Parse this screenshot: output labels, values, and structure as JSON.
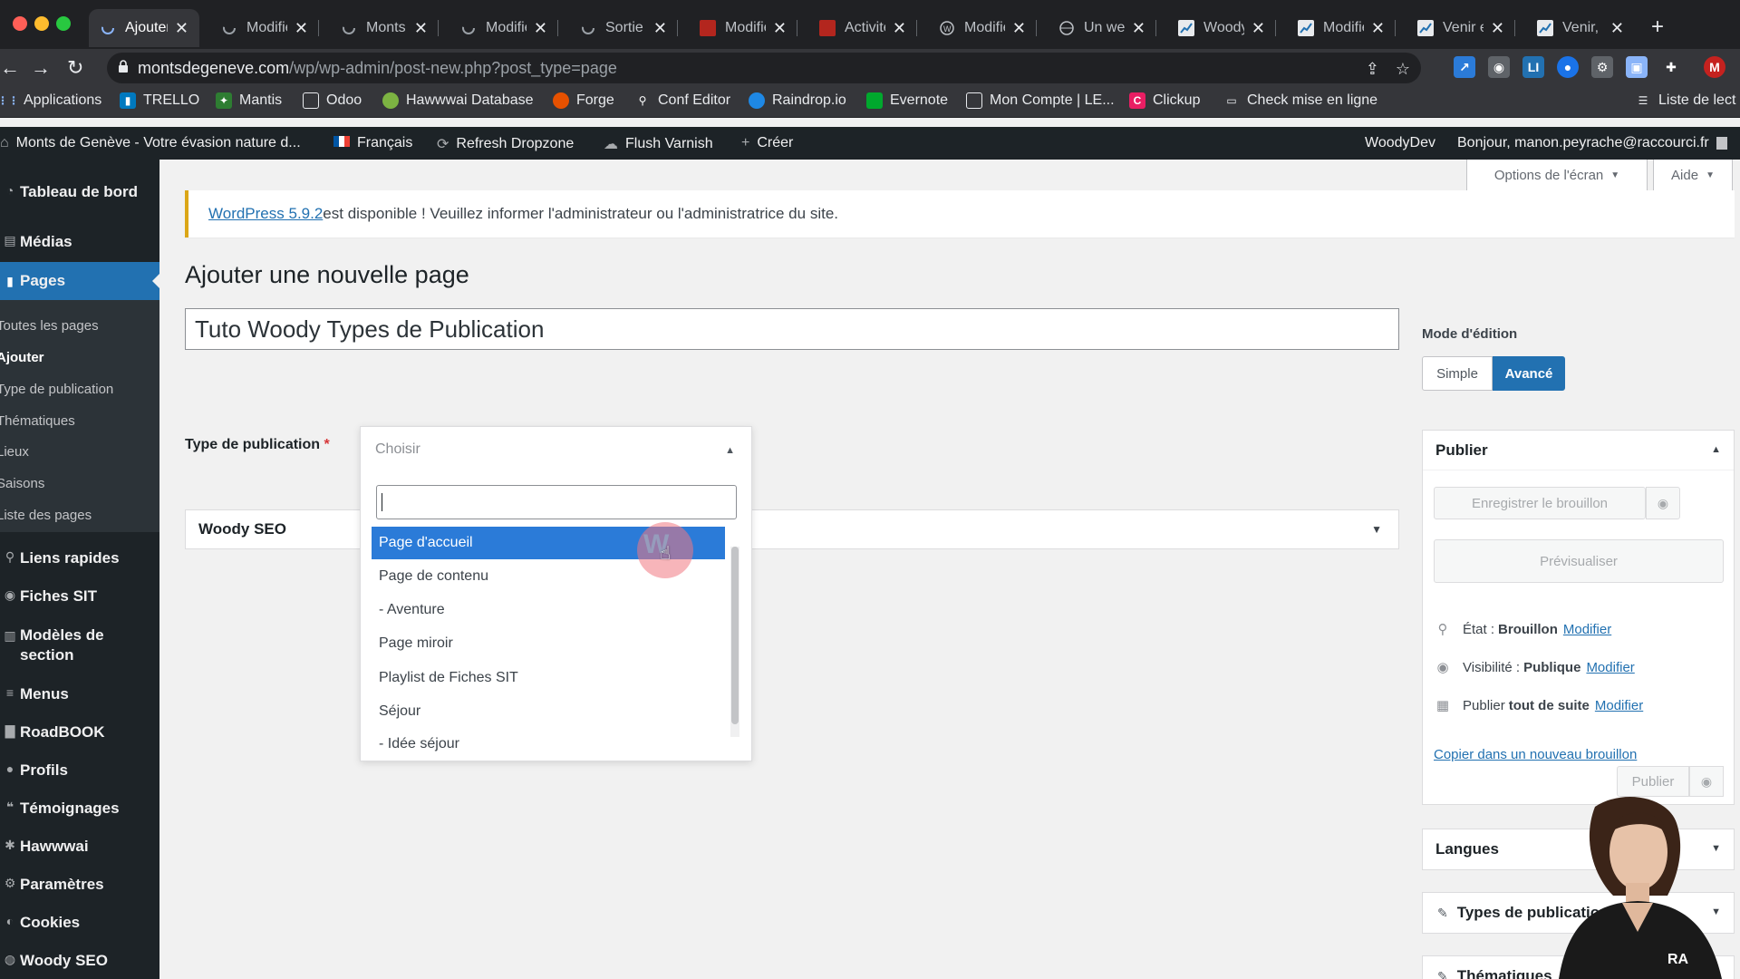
{
  "browser": {
    "tabs": [
      {
        "title": "Ajouter",
        "active": true
      },
      {
        "title": "Modifie"
      },
      {
        "title": "Monts"
      },
      {
        "title": "Modifie"
      },
      {
        "title": "Sortie"
      },
      {
        "title": "Modifie"
      },
      {
        "title": "Activité"
      },
      {
        "title": "Modifie"
      },
      {
        "title": "Un we"
      },
      {
        "title": "Woody"
      },
      {
        "title": "Modifie"
      },
      {
        "title": "Venir e"
      },
      {
        "title": "Venir,"
      }
    ],
    "url_domain": "montsdegeneve.com",
    "url_path": "/wp/wp-admin/post-new.php?post_type=page",
    "profile_initial": "M",
    "bookmarks": [
      "Applications",
      "TRELLO",
      "Mantis",
      "Odoo",
      "Hawwwai Database",
      "Forge",
      "Conf Editor",
      "Raindrop.io",
      "Evernote",
      "Mon Compte | LE...",
      "Clickup",
      "Check mise en ligne",
      "Liste de lect"
    ]
  },
  "adminbar": {
    "site": "Monts de Genève - Votre évasion nature d...",
    "language": "Français",
    "refresh": "Refresh Dropzone",
    "flush": "Flush Varnish",
    "create": "Créer",
    "env": "WoodyDev",
    "greeting": "Bonjour, manon.peyrache@raccourci.fr"
  },
  "sidebar": {
    "items": [
      "Tableau de bord",
      "Médias",
      "Pages",
      "Liens rapides",
      "Fiches SIT",
      "Modèles de section",
      "Menus",
      "RoadBOOK",
      "Profils",
      "Témoignages",
      "Hawwwai",
      "Paramètres",
      "Cookies",
      "Woody SEO"
    ],
    "submenu": [
      "Toutes les pages",
      "Ajouter",
      "Type de publication",
      "Thématiques",
      "Lieux",
      "Saisons",
      "Liste des pages"
    ]
  },
  "screen": {
    "options_label": "Options de l'écran",
    "help_label": "Aide"
  },
  "notice": {
    "link": "WordPress 5.9.2",
    "text": " est disponible ! Veuillez informer l'administrateur ou l'administratrice du site."
  },
  "main": {
    "heading": "Ajouter une nouvelle page",
    "title_value": "Tuto Woody Types de Publication",
    "publication_type_label": "Type de publication",
    "required_mark": "*",
    "seo_box": "Woody SEO"
  },
  "select": {
    "display": "Choisir",
    "search_value": "",
    "options": [
      "Page d'accueil",
      "Page de contenu",
      "- Aventure",
      "Page miroir",
      "Playlist de Fiches SIT",
      "Séjour",
      "- Idée séjour"
    ],
    "highlighted_index": 0
  },
  "right": {
    "mode_label": "Mode d'édition",
    "mode_simple": "Simple",
    "mode_advanced": "Avancé",
    "publish_title": "Publier",
    "save_draft": "Enregistrer le brouillon",
    "preview": "Prévisualiser",
    "status_label": "État :",
    "status_value": "Brouillon",
    "visibility_label": "Visibilité :",
    "visibility_value": "Publique",
    "publish_label": "Publier",
    "publish_value": "tout de suite",
    "edit_link": "Modifier",
    "copy_link": "Copier dans un nouveau brouillon",
    "publish_button": "Publier",
    "languages_title": "Langues",
    "types_title": "Types de publication",
    "thematiques_title": "Thématiques"
  },
  "colors": {
    "wp_blue": "#2271b1",
    "admin_dark": "#1d2327",
    "notice_yellow": "#dba617",
    "highlight": "#2b7bd8"
  }
}
